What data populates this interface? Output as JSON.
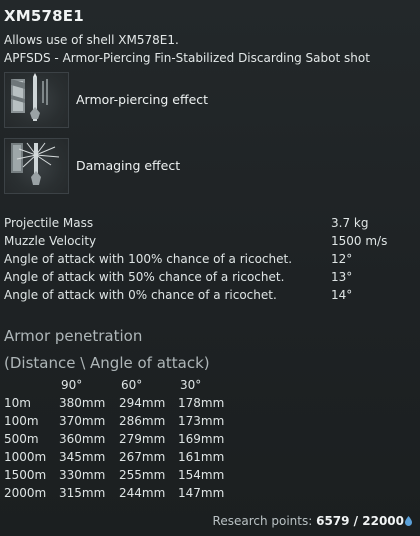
{
  "header": {
    "title": "XM578E1",
    "allows_text": "Allows use of shell XM578E1.",
    "shell_type_text": "APFSDS - Armor-Piercing Fin-Stabilized Discarding Sabot shot"
  },
  "effects": [
    {
      "label": "Armor-piercing effect",
      "icon": "armor-piercing-effect-icon"
    },
    {
      "label": "Damaging effect",
      "icon": "damaging-effect-icon"
    }
  ],
  "stats": [
    {
      "key": "Projectile Mass",
      "value": "3.7 kg"
    },
    {
      "key": "Muzzle Velocity",
      "value": "1500 m/s"
    },
    {
      "key": "Angle of attack with 100% chance of a ricochet.",
      "value": "12°"
    },
    {
      "key": "Angle of attack with 50% chance of a ricochet.",
      "value": "13°"
    },
    {
      "key": "Angle of attack with 0% chance of a ricochet.",
      "value": "14°"
    }
  ],
  "penetration": {
    "title": "Armor penetration",
    "subtitle": "(Distance \\ Angle of attack)",
    "angles": [
      "90°",
      "60°",
      "30°"
    ],
    "rows": [
      {
        "distance": "10m",
        "values": [
          "380mm",
          "294mm",
          "178mm"
        ]
      },
      {
        "distance": "100m",
        "values": [
          "370mm",
          "286mm",
          "173mm"
        ]
      },
      {
        "distance": "500m",
        "values": [
          "360mm",
          "279mm",
          "169mm"
        ]
      },
      {
        "distance": "1000m",
        "values": [
          "345mm",
          "267mm",
          "161mm"
        ]
      },
      {
        "distance": "1500m",
        "values": [
          "330mm",
          "255mm",
          "154mm"
        ]
      },
      {
        "distance": "2000m",
        "values": [
          "315mm",
          "244mm",
          "147mm"
        ]
      }
    ]
  },
  "research": {
    "label": "Research points: ",
    "value": "6579 / 22000",
    "icon": "research-points-icon",
    "icon_color": "#5aa0d8"
  }
}
